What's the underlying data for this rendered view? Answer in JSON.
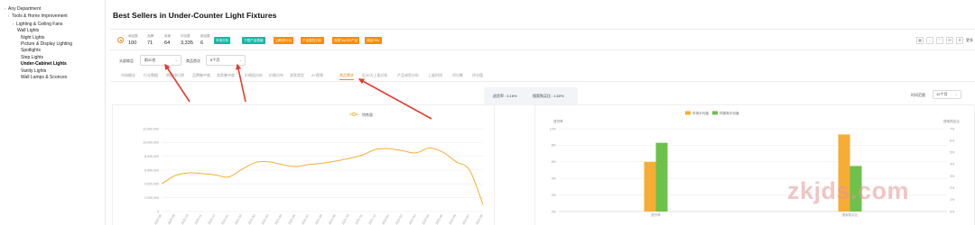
{
  "sidebar": {
    "items": [
      {
        "label": "Any Department"
      },
      {
        "label": "Tools & Home Improvement"
      },
      {
        "label": "Lighting & Ceiling Fans"
      },
      {
        "label": "Wall Lights"
      },
      {
        "label": "Night Lights"
      },
      {
        "label": "Picture & Display Lighting"
      },
      {
        "label": "Spotlights"
      },
      {
        "label": "Step Lights"
      },
      {
        "label": "Under-Cabinet Lights"
      },
      {
        "label": "Vanity Lights"
      },
      {
        "label": "Wall Lamps & Sconces"
      }
    ]
  },
  "header": {
    "title": "Best Sellers in Under-Counter Light Fixtures"
  },
  "stats": [
    {
      "label": "商品数",
      "value": "100"
    },
    {
      "label": "品牌",
      "value": "71"
    },
    {
      "label": "卖家",
      "value": "64"
    },
    {
      "label": "评论数",
      "value": "3,335"
    },
    {
      "label": "新品数",
      "value": "6"
    }
  ],
  "badges": [
    {
      "label": "市场分析",
      "color": "#14b8a6"
    },
    {
      "label": "下载产品表格",
      "color": "#14b8a6"
    },
    {
      "label": "加购物分析",
      "color": "#ff8a00"
    },
    {
      "label": "产品属性分析",
      "color": "#ff8a00"
    },
    {
      "label": "查看Top100产品",
      "color": "#ff8a00"
    },
    {
      "label": "商品SKU",
      "color": "#ff8a00"
    }
  ],
  "toolbar": {
    "more_label": "更多"
  },
  "filters": {
    "brand_label": "头部商品",
    "brand_value": "前20名",
    "price_label": "商品首次",
    "price_value": "6个月"
  },
  "tabs": [
    {
      "label": "市场概况"
    },
    {
      "label": "行业数据"
    },
    {
      "label": "销量排行榜"
    },
    {
      "label": "品牌集中度"
    },
    {
      "label": "卖家集中度"
    },
    {
      "label": "价格段分析"
    },
    {
      "label": "价格分布"
    },
    {
      "label": "卖家类型"
    },
    {
      "label": "A+视频"
    },
    {
      "label": "商品需求"
    },
    {
      "label": "近30天上架分析"
    },
    {
      "label": "产品体验分析"
    },
    {
      "label": "上架时间"
    },
    {
      "label": "评分数"
    },
    {
      "label": "评分值"
    }
  ],
  "metrics": {
    "left": "退货率 : 6.16%",
    "right": "搜索购买比 : 4.60%"
  },
  "time_filter": {
    "label": "时间范围",
    "value": "12个月"
  },
  "watermark": "zkjds.com",
  "colors": {
    "accent": "#f08a24",
    "teal": "#14b8a6",
    "orange_bar": "#f6ad33",
    "green_bar": "#6cc24a"
  },
  "chart_data": [
    {
      "type": "line",
      "legend": [
        "销售量"
      ],
      "x": [
        "2020-08",
        "2020-09",
        "2020-10",
        "2020-11",
        "2020-12",
        "2021-01",
        "2021-02",
        "2021-03",
        "2021-04",
        "2021-05",
        "2021-06",
        "2021-07",
        "2021-08",
        "2021-09",
        "2021-10",
        "2021-11",
        "2021-12",
        "2022-01",
        "2022-02",
        "2022-03",
        "2022-04",
        "2022-05",
        "2022-06",
        "2022-07",
        "2022-08"
      ],
      "series": [
        {
          "name": "销售量",
          "values": [
            4000000,
            5200000,
            5600000,
            5500000,
            5300000,
            5000000,
            6100000,
            7100000,
            7200000,
            6800000,
            6500000,
            6800000,
            7000000,
            7300000,
            7700000,
            8200000,
            9000000,
            9100000,
            8800000,
            8500000,
            9200000,
            8600000,
            7200000,
            6000000,
            1000000
          ]
        }
      ],
      "yticks": [
        "0",
        "2,000,000",
        "4,000,000",
        "6,000,000",
        "8,000,000",
        "10,000,000",
        "12,000,000"
      ],
      "ylim": [
        0,
        12000000
      ]
    },
    {
      "type": "bar",
      "legend": [
        "市场平均值",
        "同类商平均值"
      ],
      "left_axis_title": "退货率",
      "right_axis_title": "搜索购买比",
      "categories": [
        "退货率",
        "搜索购买比"
      ],
      "series": [
        {
          "name": "市场平均值",
          "values": [
            6.0,
            9.3
          ]
        },
        {
          "name": "同类商平均值",
          "values": [
            8.3,
            5.5
          ]
        }
      ],
      "left_ticks": [
        "0%",
        "2%",
        "4%",
        "6%",
        "8%",
        "10%"
      ],
      "right_ticks": [
        "0%",
        "1%",
        "2%",
        "3%",
        "4%",
        "5%",
        "6%",
        "7%"
      ],
      "ylim": [
        0,
        10
      ]
    }
  ]
}
